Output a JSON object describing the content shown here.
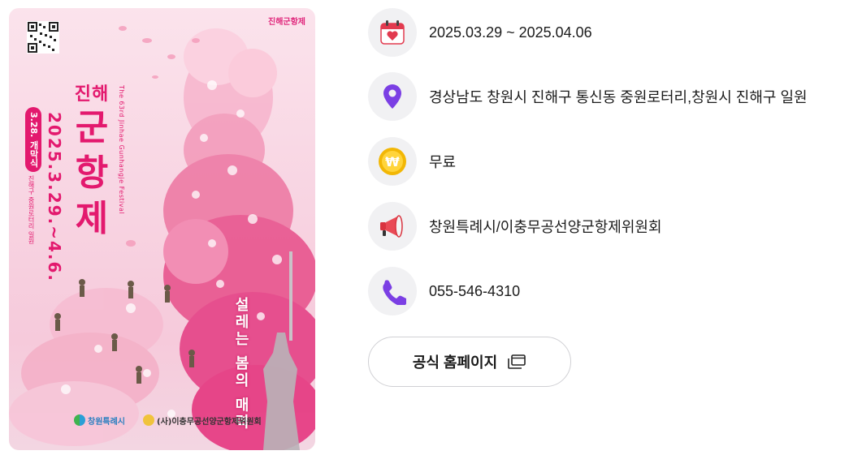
{
  "poster": {
    "top_logo": "진해군항제",
    "title_small": "진해",
    "title_chars": [
      "군",
      "항",
      "제"
    ],
    "english_title": "The 63rd Jinhae Gunhangje Festival",
    "dates": "2025.3.29.~4.6.",
    "opening_badge": "3.28. 개막식",
    "venue": "진해구 중원로터리 일원",
    "slogan": "설레는 봄의 매력",
    "sponsor_left": "창원특례시",
    "sponsor_right": "(사)이충무공선양군항제위원회",
    "colors": {
      "accent": "#e3196e",
      "background": "#f8d4e2"
    }
  },
  "info": {
    "date": {
      "icon": "calendar-heart-icon",
      "text": "2025.03.29 ~ 2025.04.06"
    },
    "location": {
      "icon": "map-pin-icon",
      "text": "경상남도 창원시 진해구 통신동 중원로터리,창원시 진해구 일원"
    },
    "fee": {
      "icon": "won-coin-icon",
      "text": "무료"
    },
    "organizer": {
      "icon": "megaphone-icon",
      "text": "창원특례시/이충무공선양군항제위원회"
    },
    "phone": {
      "icon": "phone-icon",
      "text": "055-546-4310"
    }
  },
  "homepage_button": {
    "label": "공식 홈페이지",
    "icon": "external-window-icon"
  }
}
